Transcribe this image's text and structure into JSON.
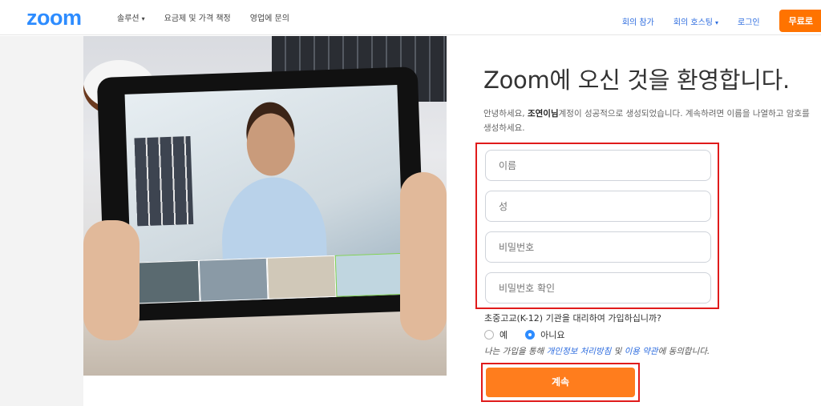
{
  "header": {
    "logo": "zoom",
    "nav": {
      "solutions": "솔루션",
      "pricing": "요금제 및 가격 책정",
      "contact_sales": "영업에 문의"
    },
    "right": {
      "join": "회의 참가",
      "host": "회의 호스팅",
      "signin": "로그인",
      "signup_free": "무료로"
    }
  },
  "form": {
    "title": "Zoom에 오신 것을 환영합니다.",
    "intro_prefix": "안녕하세요, ",
    "intro_account": "조연이님",
    "intro_suffix": "계정이 성공적으로 생성되었습니다. 계속하려면 이름을 나열하고 암호를 생성하세요.",
    "first_name_placeholder": "이름",
    "last_name_placeholder": "성",
    "password_placeholder": "비밀번호",
    "confirm_password_placeholder": "비밀번호 확인",
    "k12_question": "초중고교(K-12) 기관을 대리하여 가입하십니까?",
    "k12_yes": "예",
    "k12_no": "아니요",
    "k12_selected": "아니요",
    "agree_prefix": "나는 가입을 통해 ",
    "privacy_link": "개인정보 처리방침",
    "agree_and": " 및 ",
    "terms_link": "이용 약관",
    "agree_suffix": "에 동의합니다.",
    "continue_label": "계속"
  },
  "colors": {
    "brand_blue": "#2d8cff",
    "orange": "#ff7d1d",
    "highlight_red": "#e01b1b"
  }
}
